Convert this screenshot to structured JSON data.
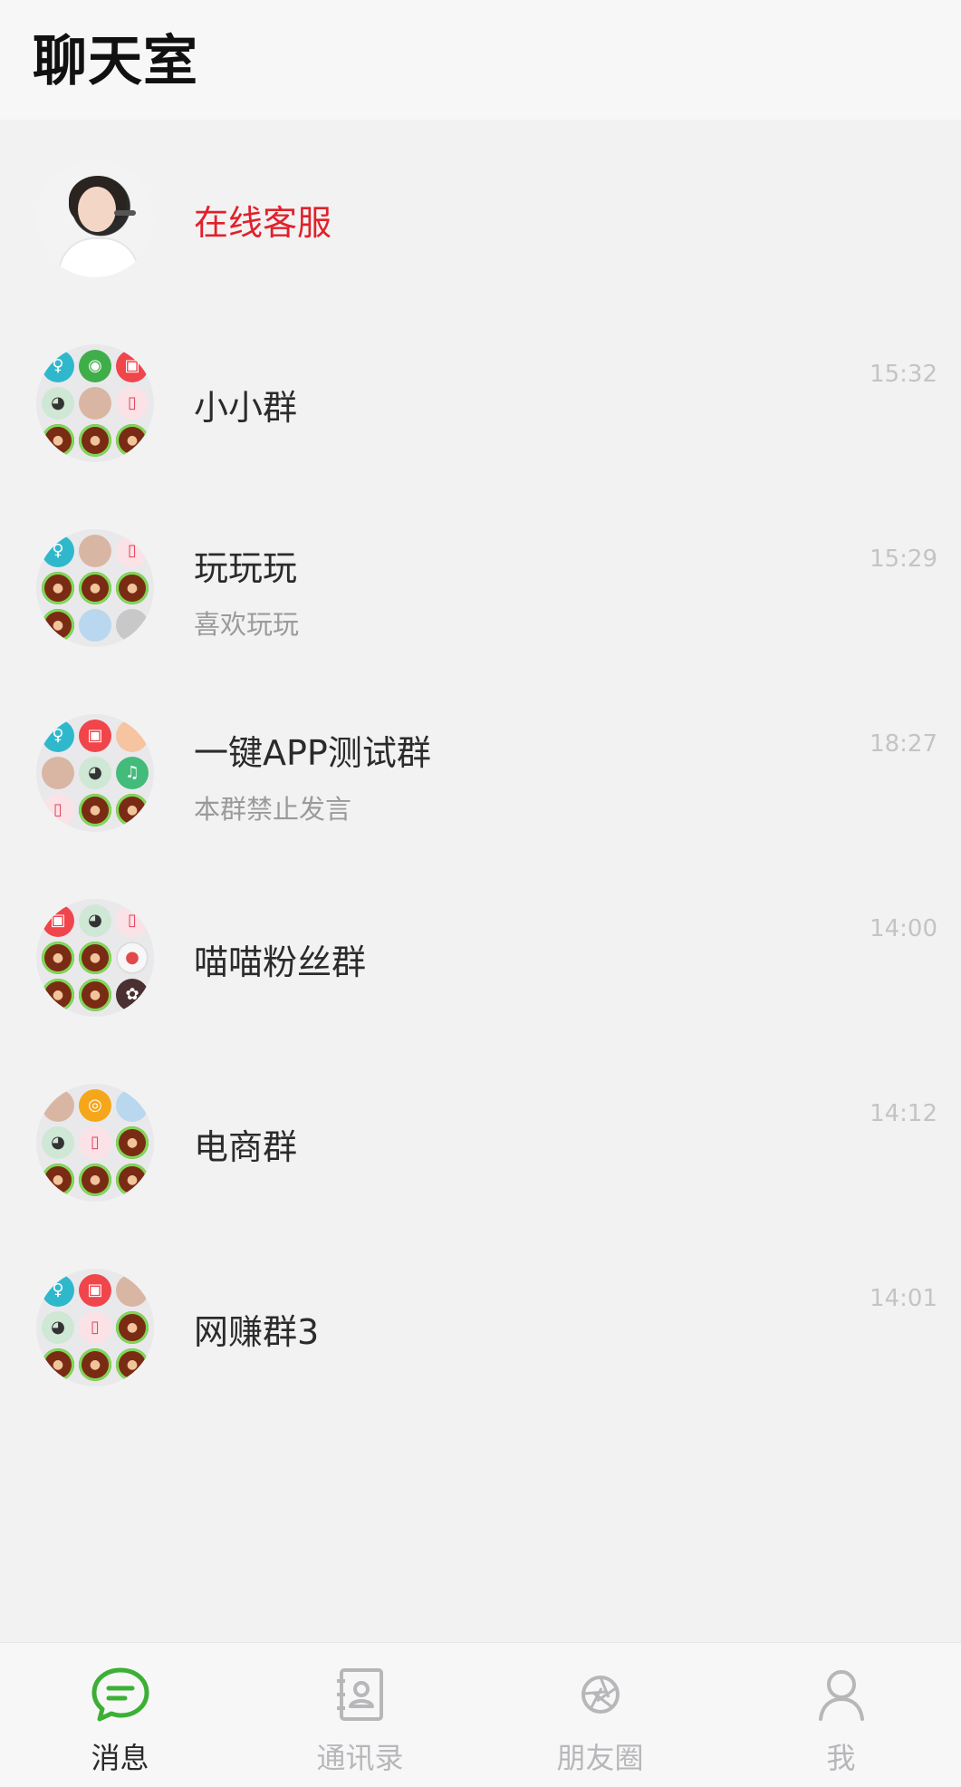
{
  "header": {
    "title": "聊天室"
  },
  "chats": [
    {
      "title": "在线客服",
      "subtitle": "",
      "time": "",
      "highlight": true,
      "avatar": "customer-service-photo"
    },
    {
      "title": "小小群",
      "subtitle": "",
      "time": "15:32",
      "avatar_cells": [
        "teal",
        "green",
        "red",
        "panda",
        "person",
        "pink",
        "bear",
        "bear",
        "bear"
      ]
    },
    {
      "title": "玩玩玩",
      "subtitle": "喜欢玩玩",
      "time": "15:29",
      "avatar_cells": [
        "teal",
        "person",
        "pink",
        "bear",
        "bear",
        "bear",
        "bear",
        "blue",
        "gray"
      ]
    },
    {
      "title": "一键APP测试群",
      "subtitle": "本群禁止发言",
      "time": "18:27",
      "avatar_cells": [
        "teal",
        "red",
        "peach",
        "person",
        "panda",
        "music",
        "pink",
        "bear",
        "bear"
      ]
    },
    {
      "title": "喵喵粉丝群",
      "subtitle": "",
      "time": "14:00",
      "avatar_cells": [
        "red",
        "panda",
        "pink",
        "bear",
        "bear",
        "white",
        "bear",
        "bear",
        "dark"
      ]
    },
    {
      "title": "电商群",
      "subtitle": "",
      "time": "14:12",
      "avatar_cells": [
        "person",
        "orange",
        "blue",
        "panda",
        "pink",
        "bear",
        "bear",
        "bear",
        "bear"
      ]
    },
    {
      "title": "网赚群3",
      "subtitle": "",
      "time": "14:01",
      "avatar_cells": [
        "teal",
        "red",
        "person",
        "panda",
        "pink",
        "bear",
        "bear",
        "bear",
        "bear"
      ]
    }
  ],
  "tabbar": {
    "tabs": [
      {
        "label": "消息",
        "icon": "chat-bubble-icon",
        "active": true
      },
      {
        "label": "通讯录",
        "icon": "contacts-book-icon",
        "active": false
      },
      {
        "label": "朋友圈",
        "icon": "aperture-icon",
        "active": false
      },
      {
        "label": "我",
        "icon": "person-icon",
        "active": false
      }
    ]
  },
  "colors": {
    "accent": "#3cb034",
    "highlight_text": "#e0212b",
    "background": "#f2f2f3"
  }
}
